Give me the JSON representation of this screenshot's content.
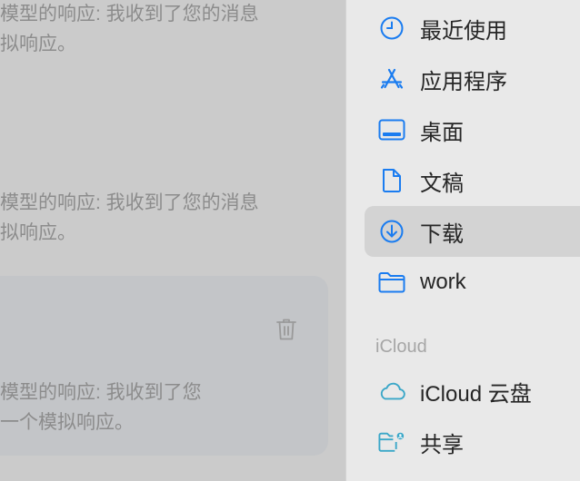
{
  "chat": {
    "message1": [
      "模型的响应: 我收到了您的消息",
      "拟响应。"
    ],
    "message2": [
      "模型的响应: 我收到了您的消息",
      "拟响应。"
    ],
    "message3": [
      "模型的响应: 我收到了您",
      "一个模拟响应。"
    ]
  },
  "sidebar": {
    "items": [
      {
        "label": "最近使用",
        "icon": "clock-icon"
      },
      {
        "label": "应用程序",
        "icon": "app-store-icon"
      },
      {
        "label": "桌面",
        "icon": "desktop-icon"
      },
      {
        "label": "文稿",
        "icon": "document-icon"
      },
      {
        "label": "下载",
        "icon": "download-icon"
      },
      {
        "label": "work",
        "icon": "folder-icon"
      }
    ],
    "section_icloud": "iCloud",
    "icloud_items": [
      {
        "label": "iCloud 云盘",
        "icon": "cloud-icon"
      },
      {
        "label": "共享",
        "icon": "shared-folder-icon"
      }
    ],
    "selected_index": 4
  },
  "colors": {
    "accent": "#1a7cf0",
    "icloud": "#3aa7c8",
    "sidebar_bg": "#e9e9e9",
    "selected_bg": "#d3d3d3"
  }
}
